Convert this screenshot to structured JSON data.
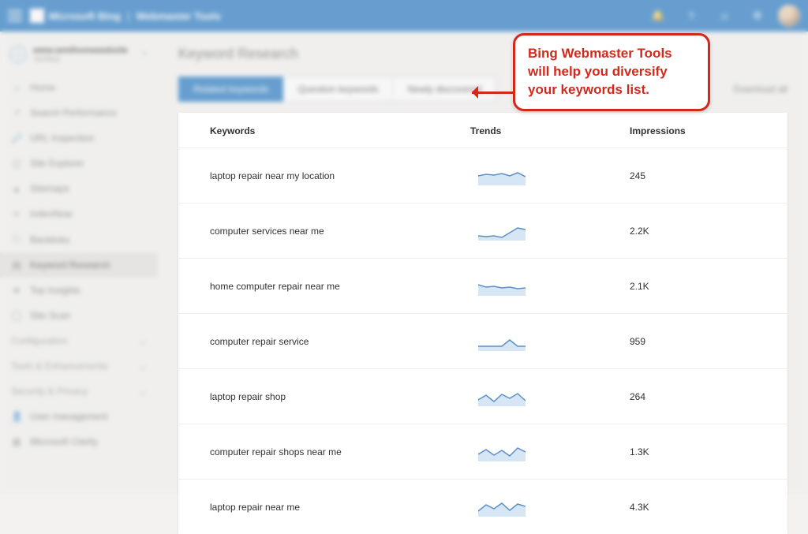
{
  "header": {
    "brand_primary": "Microsoft Bing",
    "brand_secondary": "Webmaster Tools"
  },
  "site_picker": {
    "domain": "www.wmthomewebsite",
    "status": "Verified"
  },
  "sidebar": {
    "items": [
      {
        "icon": "⌂",
        "label": "Home"
      },
      {
        "icon": "↗",
        "label": "Search Performance"
      },
      {
        "icon": "🔎",
        "label": "URL Inspection"
      },
      {
        "icon": "◫",
        "label": "Site Explorer"
      },
      {
        "icon": "▲",
        "label": "Sitemaps"
      },
      {
        "icon": "≡",
        "label": "IndexNow"
      },
      {
        "icon": "⎋",
        "label": "Backlinks"
      },
      {
        "icon": "▤",
        "label": "Keyword Research"
      },
      {
        "icon": "★",
        "label": "Top Insights"
      },
      {
        "icon": "◯",
        "label": "Site Scan"
      }
    ],
    "active_index": 7,
    "groups": [
      {
        "label": "Configuration"
      },
      {
        "label": "Tools & Enhancements"
      },
      {
        "label": "Security & Privacy"
      }
    ],
    "footer_items": [
      {
        "icon": "👤",
        "label": "User management"
      },
      {
        "icon": "▦",
        "label": "Microsoft Clarity"
      }
    ]
  },
  "page": {
    "title": "Keyword Research",
    "tabs": [
      {
        "label": "Related keywords"
      },
      {
        "label": "Question keywords"
      },
      {
        "label": "Newly discovered"
      }
    ],
    "active_tab": 0,
    "download_label": "Download all"
  },
  "table": {
    "columns": {
      "keywords": "Keywords",
      "trends": "Trends",
      "impressions": "Impressions"
    },
    "rows": [
      {
        "keyword": "laptop repair near my location",
        "trend": "0,12 10,10 20,11 30,9 40,12 50,8 60,13",
        "impressions": "245"
      },
      {
        "keyword": "computer services near me",
        "trend": "0,18 10,19 20,18 30,20 40,14 50,8 60,10",
        "impressions": "2.2K"
      },
      {
        "keyword": "home computer repair near me",
        "trend": "0,10 10,13 20,12 30,14 40,13 50,15 60,14",
        "impressions": "2.1K"
      },
      {
        "keyword": "computer repair service",
        "trend": "0,18 10,18 20,18 30,18 40,10 50,18 60,18",
        "impressions": "959"
      },
      {
        "keyword": "laptop repair shop",
        "trend": "0,16 10,10 20,18 30,9 40,14 50,8 60,17",
        "impressions": "264"
      },
      {
        "keyword": "computer repair shops near me",
        "trend": "0,15 10,9 20,16 30,10 40,17 50,7 60,12",
        "impressions": "1.3K"
      },
      {
        "keyword": "laptop repair near me",
        "trend": "0,17 10,9 20,14 30,7 40,16 50,8 60,11",
        "impressions": "4.3K"
      }
    ]
  },
  "annotation": {
    "text": "Bing Webmaster Tools will help you diversify your keywords list."
  },
  "colors": {
    "brand_blue": "#0f6cbd",
    "callout_red": "#d4281a",
    "trend_stroke": "#5b8fc7",
    "trend_fill": "#d7e6f5"
  }
}
